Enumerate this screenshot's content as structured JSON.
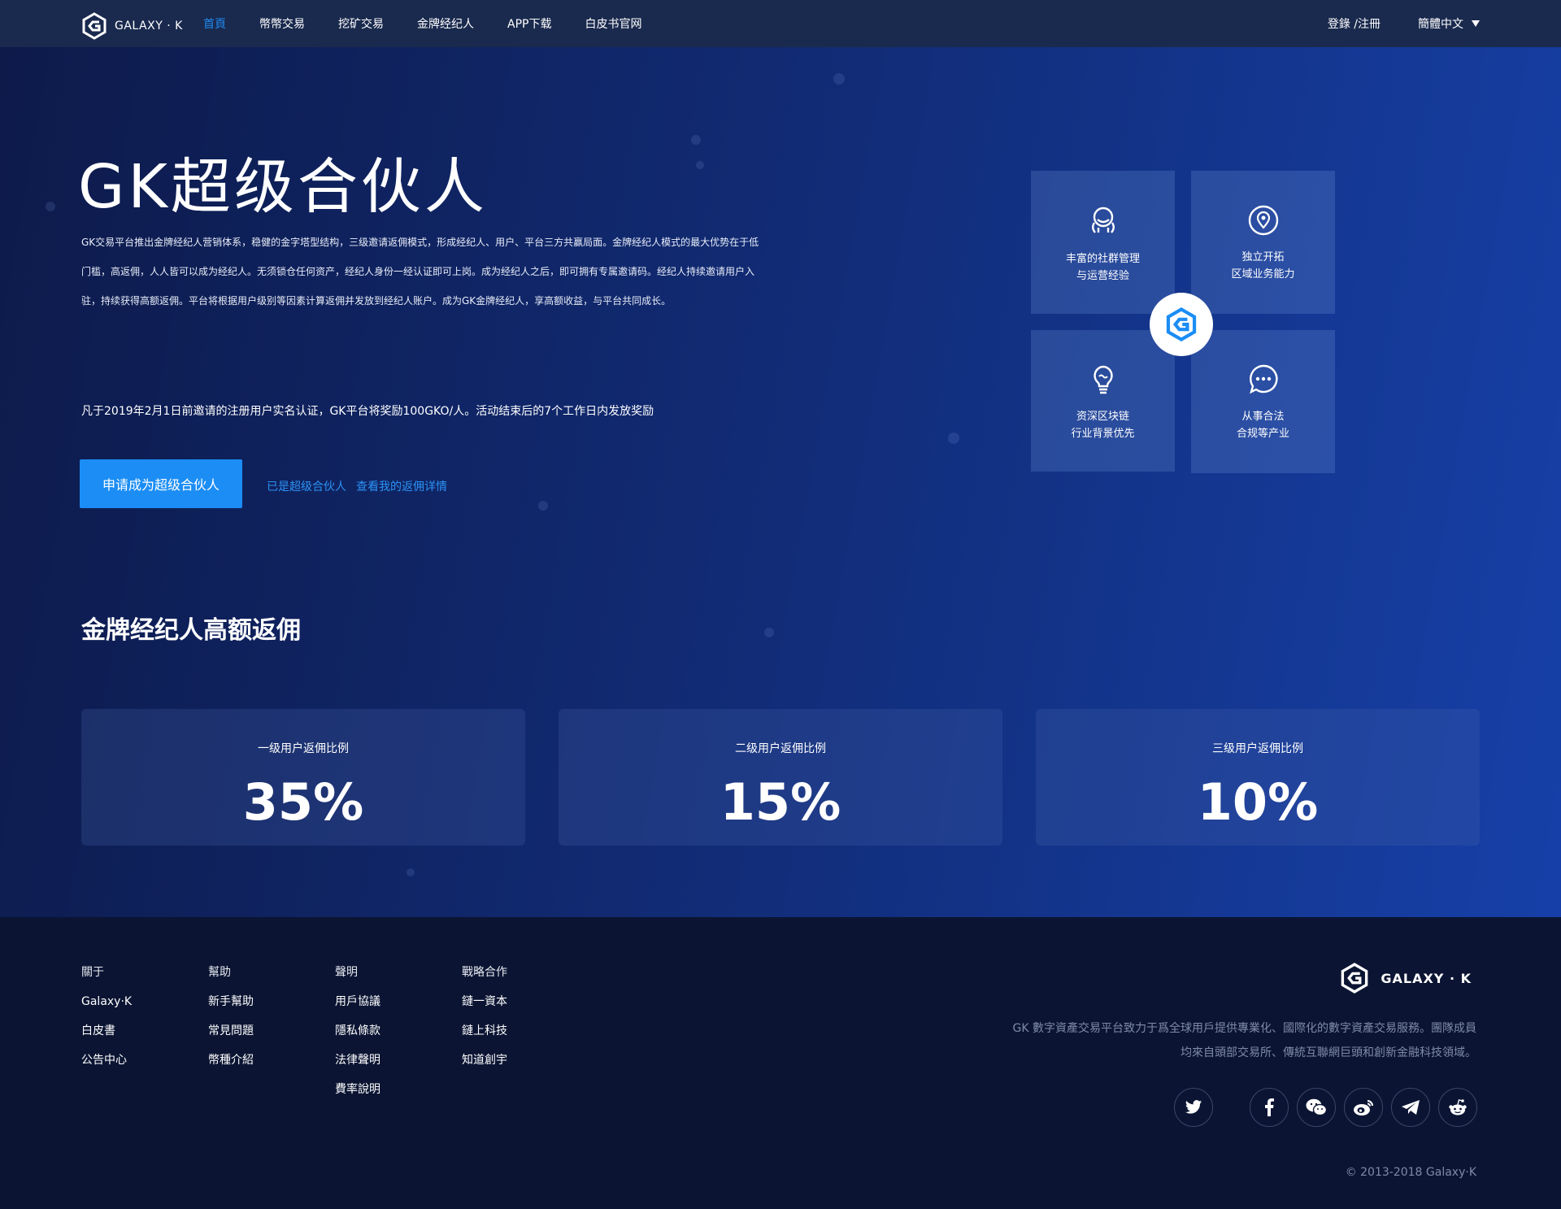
{
  "nav": {
    "logo_text": "GALAXY · K",
    "links": [
      "首頁",
      "幣幣交易",
      "挖矿交易",
      "金牌经纪人",
      "APP下载",
      "白皮书官网"
    ],
    "active_index": 0,
    "login": "登錄 /注冊",
    "language": "簡體中文"
  },
  "hero": {
    "title": "GK超级合伙人",
    "desc": "GK交易平台推出金牌经纪人营销体系，稳健的金字塔型结构，三级邀请返佣模式，形成经纪人、用户、平台三方共赢局面。金牌经纪人模式的最大优势在于低门槛，高返佣，人人皆可以成为经纪人。无须锁仓任何资产，经纪人身份一经认证即可上岗。成为经纪人之后，即可拥有专属邀请码。经纪人持续邀请用户入驻，持续获得高额返佣。平台将根据用户级别等因素计算返佣并发放到经纪人账户。成为GK金牌经纪人，享高额收益，与平台共同成长。",
    "note": "凡于2019年2月1日前邀请的注册用户实名认证，GK平台将奖励100GKO/人。活动结束后的7个工作日内发放奖励",
    "apply_button": "申请成为超级合伙人",
    "link_already": "已是超级合伙人",
    "link_details": "查看我的返佣详情"
  },
  "tiles": [
    {
      "icon": "community-icon",
      "line1": "丰富的社群管理",
      "line2": "与运营经验"
    },
    {
      "icon": "location-icon",
      "line1": "独立开拓",
      "line2": "区域业务能力"
    },
    {
      "icon": "lightbulb-icon",
      "line1": "资深区块链",
      "line2": "行业背景优先"
    },
    {
      "icon": "chat-icon",
      "line1": "从事合法",
      "line2": "合规等产业"
    }
  ],
  "section": {
    "title": "金牌经纪人高额返佣"
  },
  "stats": [
    {
      "label": "一级用户返佣比例",
      "value": "35%"
    },
    {
      "label": "二级用户返佣比例",
      "value": "15%"
    },
    {
      "label": "三级用户返佣比例",
      "value": "10%"
    }
  ],
  "footer": {
    "columns": [
      {
        "head": "關于",
        "items": [
          "Galaxy·K",
          "白皮書",
          "公告中心"
        ]
      },
      {
        "head": "幫助",
        "items": [
          "新手幫助",
          "常見問題",
          "幣種介紹"
        ]
      },
      {
        "head": "聲明",
        "items": [
          "用戶協議",
          "隱私條款",
          "法律聲明",
          "費率說明"
        ]
      },
      {
        "head": "戰略合作",
        "items": [
          "鏈一資本",
          "鏈上科技",
          "知道創宇"
        ]
      }
    ],
    "logo_text": "GALAXY · K",
    "desc_line1": "GK 數字資產交易平台致力于爲全球用戶提供專業化、國際化的數字資產交易服務。團隊成員",
    "desc_line2": "均來自頭部交易所、傳統互聯網巨頭和創新金融科技領域。",
    "socials": [
      "twitter-icon",
      "facebook-icon",
      "wechat-icon",
      "weibo-icon",
      "telegram-icon",
      "reddit-icon"
    ],
    "copyright": "© 2013-2018 Galaxy·K"
  },
  "colors": {
    "accent": "#1b8df5",
    "nav_bg": "#1a2a4e",
    "footer_bg": "#0b1533"
  }
}
